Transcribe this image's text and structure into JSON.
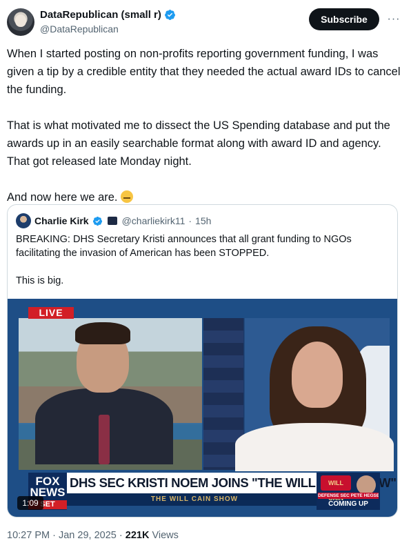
{
  "author": {
    "display_name": "DataRepublican (small r)",
    "handle": "@DataRepublican",
    "verified": true
  },
  "actions": {
    "subscribe_label": "Subscribe",
    "more_label": "···"
  },
  "tweet": {
    "paragraphs": [
      "When I started posting on non-profits reporting government funding, I was given a tip by a credible entity that they needed the actual award IDs to cancel the funding.",
      "That is what motivated me to dissect the US Spending database and put the awards up in an easily searchable format along with award ID and agency. That got released late Monday night.",
      "And now here we are."
    ],
    "emoji_icon": "saluting-face-emoji"
  },
  "quote": {
    "display_name": "Charlie Kirk",
    "handle": "@charliekirk11",
    "separator": "·",
    "time": "15h",
    "paragraphs": [
      "BREAKING: DHS Secretary Kristi announces that all grant funding to NGOs facilitating the invasion of American has been STOPPED.",
      "This is big."
    ],
    "media": {
      "live_badge": "LIVE",
      "network_top": "FOX",
      "network_mid": "NEWS",
      "network_tag": "SET",
      "headline": "DHS SEC KRISTI NOEM JOINS \"THE WILL CAIN SHOW\"",
      "show_bar": "THE WILL CAIN SHOW",
      "promo_logo": "WILL CAIN",
      "promo_sub": "DEFENSE SEC PETE HEGSETH",
      "promo_coming": "COMING UP",
      "duration": "1:09"
    }
  },
  "meta": {
    "time": "10:27 PM",
    "date": "Jan 29, 2025",
    "separator": "·",
    "views_count": "221K",
    "views_label": "Views"
  },
  "colors": {
    "verified_blue": "#1d9bf0",
    "text_secondary": "#536471",
    "live_red": "#d21f26"
  }
}
